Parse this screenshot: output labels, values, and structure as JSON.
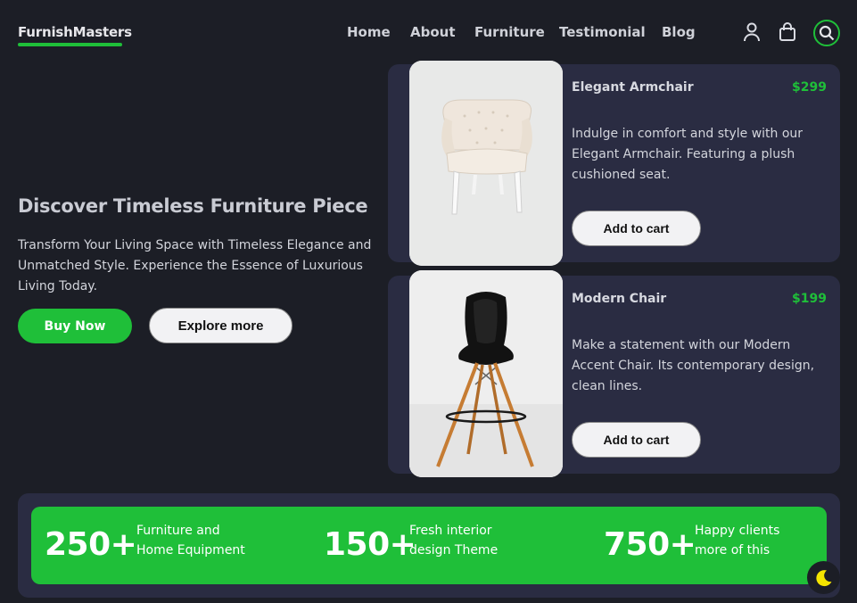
{
  "header": {
    "logo": "FurnishMasters",
    "nav": [
      "Home",
      "About",
      "Furniture",
      "Testimonial",
      "Blog"
    ],
    "icons": [
      "user-icon",
      "shopping-bag-icon",
      "search-icon"
    ],
    "accent_color": "#1fbf39"
  },
  "hero": {
    "title": "Discover Timeless Furniture Piece",
    "description": "Transform Your Living Space with Timeless Elegance and Unmatched Style. Experience the Essence of Luxurious Living Today.",
    "buy_label": "Buy Now",
    "explore_label": "Explore more"
  },
  "products": [
    {
      "name": "Elegant Armchair",
      "price": "$299",
      "description": "Indulge in comfort and style with our Elegant Armchair. Featuring a plush cushioned seat.",
      "button": "Add to cart",
      "image": "white tufted armchair"
    },
    {
      "name": "Modern Chair",
      "price": "$199",
      "description": "Make a statement with our Modern Accent Chair. Its contemporary design, clean lines.",
      "button": "Add to cart",
      "image": "black bar stool with wooden legs"
    }
  ],
  "stats": [
    {
      "number": "250+",
      "label_line1": "Furniture and",
      "label_line2": "Home Equipment"
    },
    {
      "number": "150+",
      "label_line1": "Fresh interior",
      "label_line2": "design Theme"
    },
    {
      "number": "750+",
      "label_line1": "Happy clients",
      "label_line2": "more of this"
    }
  ],
  "theme_toggle_icon": "moon-icon"
}
